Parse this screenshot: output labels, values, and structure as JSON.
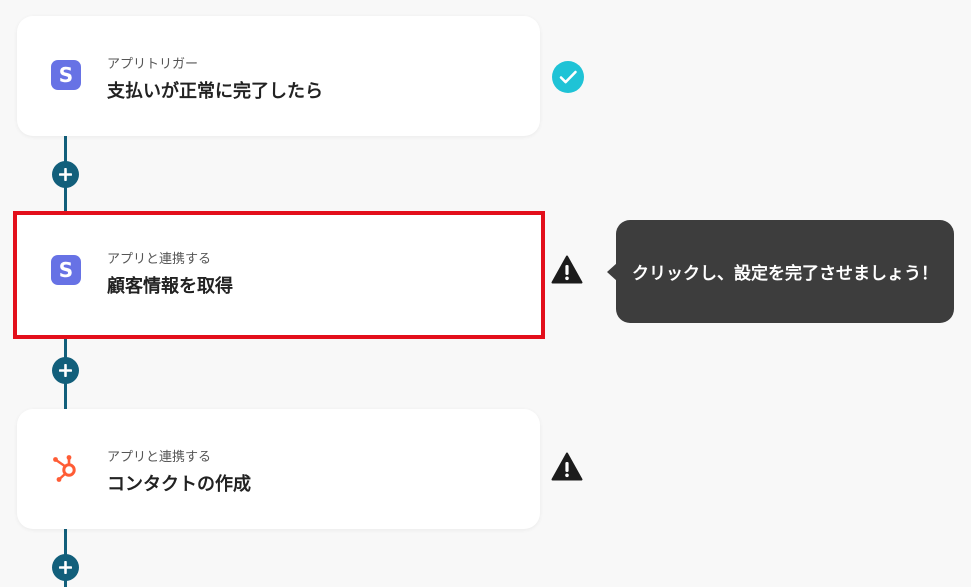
{
  "steps": [
    {
      "type_label": "アプリトリガー",
      "title": "支払いが正常に完了したら",
      "app_icon": "stripe-icon",
      "status": "complete",
      "app_logo_text": "S"
    },
    {
      "type_label": "アプリと連携する",
      "title": "顧客情報を取得",
      "app_icon": "stripe-icon",
      "status": "warning",
      "selected": true,
      "app_logo_text": "S"
    },
    {
      "type_label": "アプリと連携する",
      "title": "コンタクトの作成",
      "app_icon": "hubspot-icon",
      "status": "warning"
    }
  ],
  "tooltip": {
    "text": "クリックし、設定を完了させましょう！"
  },
  "colors": {
    "connector": "#125f7b",
    "check": "#1fc3d6",
    "highlight_border": "#e30f1b",
    "stripe": "#6772e5",
    "hubspot": "#ff5c35",
    "tooltip_bg": "#3d3d3d"
  }
}
